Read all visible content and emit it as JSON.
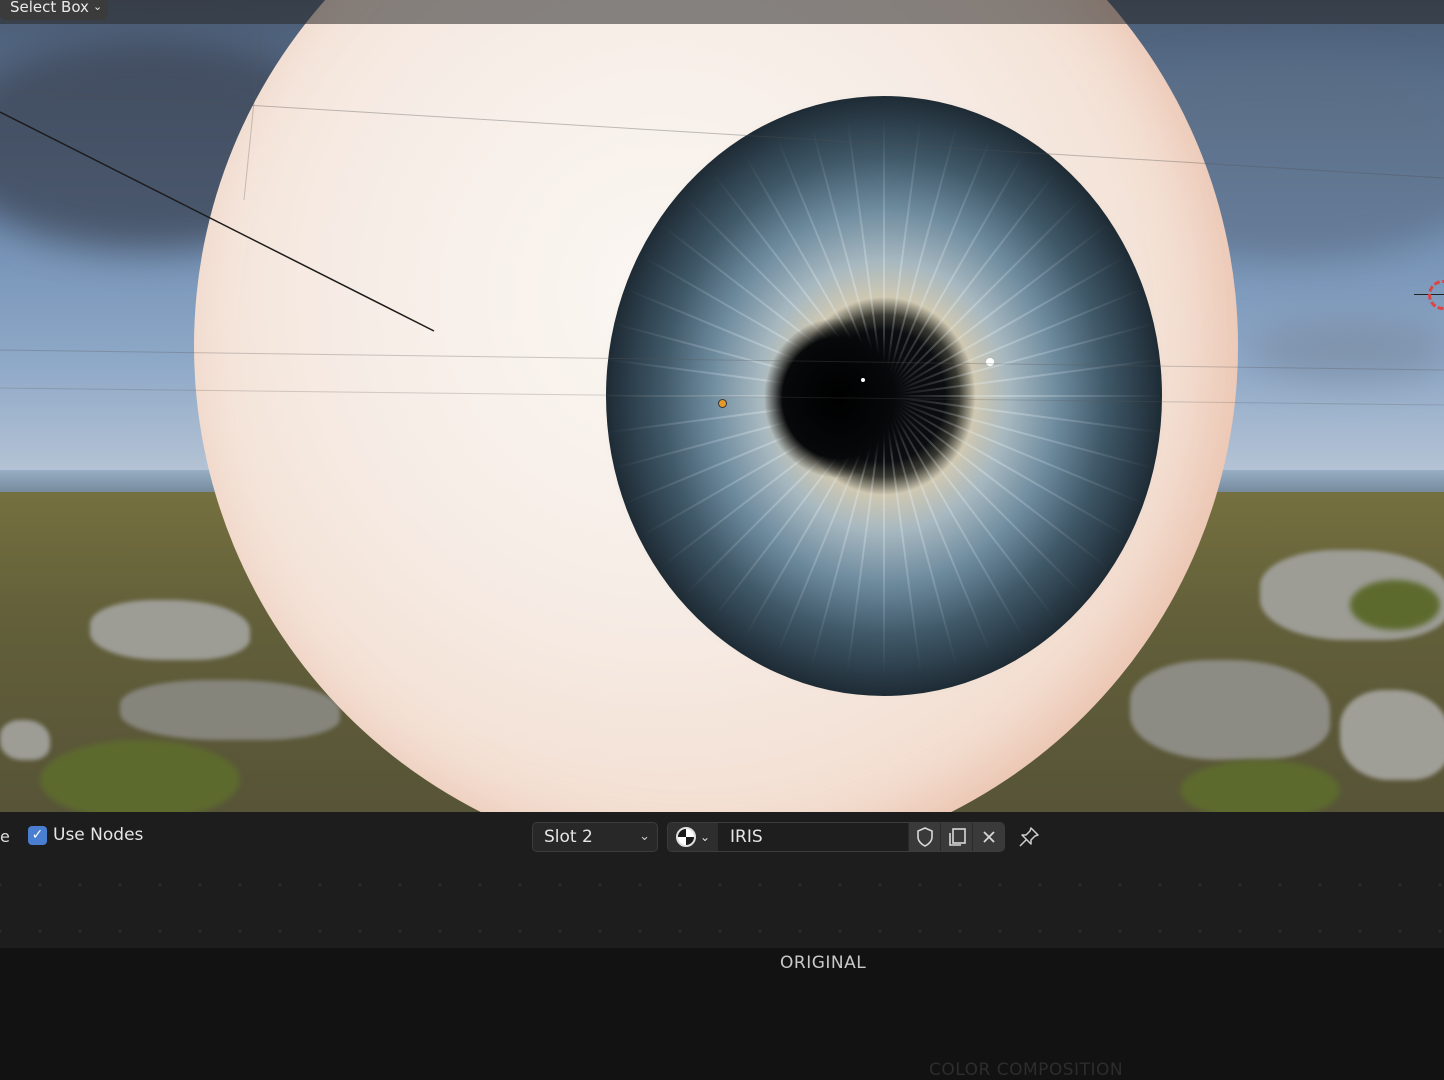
{
  "viewport": {
    "tool_selector": {
      "label": "Select Box"
    }
  },
  "node_header": {
    "partial_label": "e",
    "use_nodes": {
      "label": "Use Nodes",
      "checked": true
    },
    "slot_select": {
      "value": "Slot 2"
    },
    "material": {
      "name": "IRIS",
      "browse_icon": "material-sphere-icon",
      "fake_user_icon": "shield-icon",
      "duplicate_icon": "duplicate-icon",
      "unlink_icon": "close-icon"
    },
    "pin_icon": "pin-icon"
  },
  "captions": {
    "original": "ORIGINAL",
    "color_composition": "COLOR COMPOSITION"
  },
  "colors": {
    "checkbox_accent": "#4a7ed1",
    "editor_bg": "#1d1d1d",
    "page_bg": "#121212",
    "cursor_ring": "#dd4444"
  }
}
